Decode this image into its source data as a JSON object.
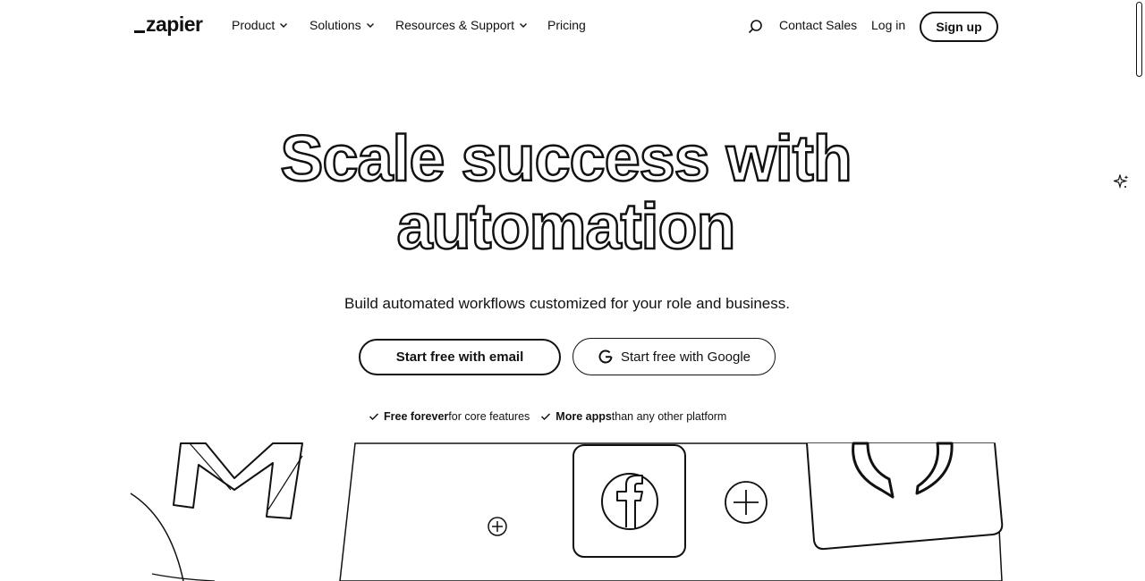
{
  "header": {
    "logo": "zapier",
    "nav": [
      {
        "label": "Product",
        "has_dropdown": true
      },
      {
        "label": "Solutions",
        "has_dropdown": true
      },
      {
        "label": "Resources & Support",
        "has_dropdown": true
      },
      {
        "label": "Pricing",
        "has_dropdown": false
      }
    ],
    "contact_sales": "Contact Sales",
    "log_in": "Log in",
    "sign_up": "Sign up"
  },
  "hero": {
    "title_line1": "Scale success with",
    "title_line2": "automation",
    "subtitle": "Build automated workflows customized for your role and business.",
    "btn_email": "Start free with email",
    "btn_google": "Start free with Google",
    "perks": [
      {
        "bold": "Free forever",
        "rest": " for core features"
      },
      {
        "bold": "More apps",
        "rest": " than any other platform"
      }
    ]
  },
  "icons": {
    "search": "search-icon",
    "sparkle": "sparkle-icon",
    "google": "google-icon",
    "check": "check-icon",
    "gmail": "gmail-icon",
    "facebook": "facebook-icon",
    "plus": "plus-icon",
    "phone": "phone-icon"
  }
}
